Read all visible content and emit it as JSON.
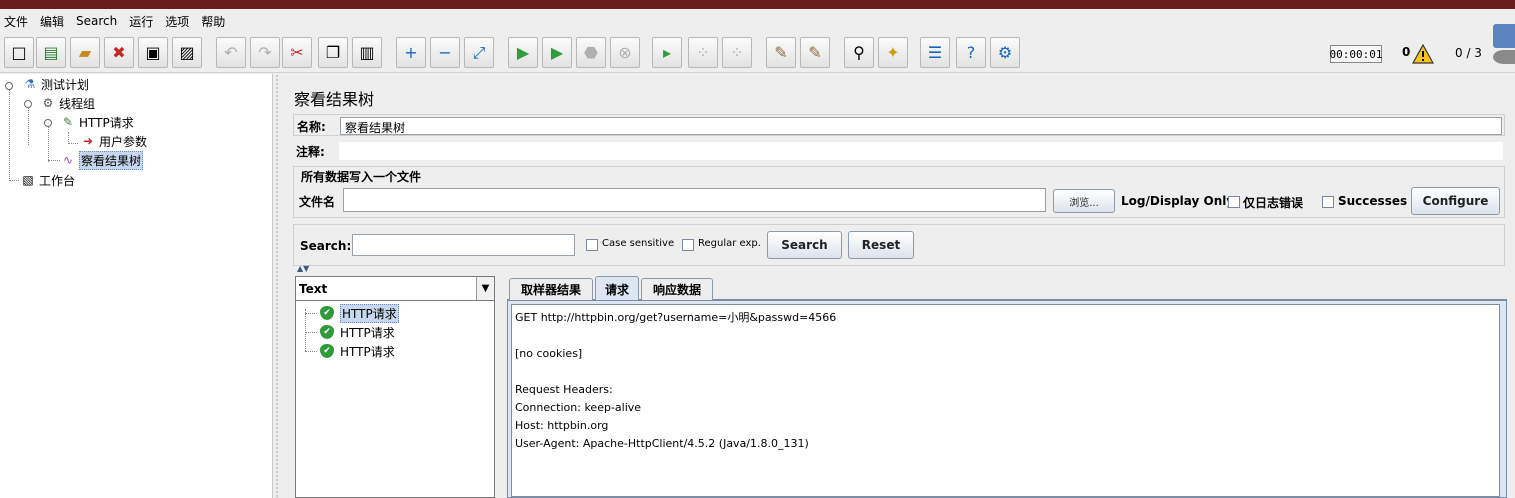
{
  "menu": [
    "文件",
    "编辑",
    "Search",
    "运行",
    "选项",
    "帮助"
  ],
  "toolbar": {
    "timer": "00:00:01",
    "errors": "0",
    "threads": "0 / 3",
    "buttons": [
      "new",
      "templates",
      "open",
      "close",
      "save",
      "save-screenshot",
      "undo",
      "redo",
      "cut",
      "copy",
      "paste",
      "expand",
      "collapse",
      "toggle",
      "start",
      "start-no-pauses",
      "stop",
      "shutdown",
      "remote-start",
      "remote-stop",
      "remote-shutdown",
      "clear",
      "clear-all",
      "search",
      "reset-search",
      "function-helper",
      "help",
      "remote"
    ]
  },
  "tree": {
    "items": [
      "测试计划",
      "线程组",
      "HTTP请求",
      "用户参数",
      "察看结果树",
      "工作台"
    ]
  },
  "panel": {
    "title": "察看结果树",
    "name_label": "名称:",
    "name_value": "察看结果树",
    "comment_label": "注释:",
    "comment_value": "",
    "file_group_title": "所有数据写入一个文件",
    "file_label": "文件名",
    "file_value": "",
    "browse_label": "浏览...",
    "log_display_label": "Log/Display Only:",
    "errors_only_label": "仅日志错误",
    "successes_label": "Successes",
    "configure_label": "Configure"
  },
  "search": {
    "label": "Search:",
    "value": "",
    "case_sensitive": "Case sensitive",
    "regex": "Regular exp.",
    "search_button": "Search",
    "reset_button": "Reset"
  },
  "results": {
    "renderer": "Text",
    "items": [
      "HTTP请求",
      "HTTP请求",
      "HTTP请求"
    ],
    "tabs": [
      "取样器结果",
      "请求",
      "响应数据"
    ],
    "active_tab": "请求",
    "request_text": "GET http://httpbin.org/get?username=小明&passwd=4566\n\n[no cookies]\n\nRequest Headers:\nConnection: keep-alive\nHost: httpbin.org\nUser-Agent: Apache-HttpClient/4.5.2 (Java/1.8.0_131)"
  }
}
